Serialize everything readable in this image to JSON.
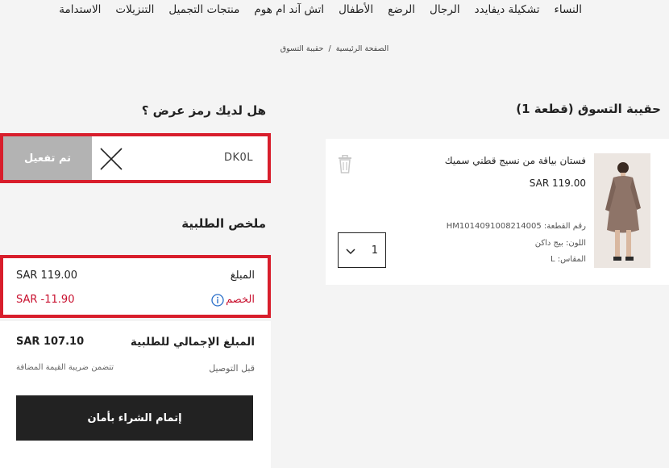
{
  "nav": [
    "النساء",
    "تشكيلة ديفايدد",
    "الرجال",
    "الرضع",
    "الأطفال",
    "اتش آند ام هوم",
    "منتجات التجميل",
    "التنزيلات",
    "الاستدامة"
  ],
  "breadcrumb": {
    "home": "الصفحة الرئيسية",
    "separator": "/",
    "current": "حقيبة التسوق"
  },
  "cart": {
    "title": "حقيبة التسوق (قطعة 1)",
    "item": {
      "name": "فستان بياقة من نسيج قطني سميك",
      "price": "SAR 119.00",
      "article_no": "رقم القطعة: HM1014091008214005",
      "color": "اللون: بيج داكن",
      "size": "المقاس: L",
      "quantity": "1",
      "image_colors": {
        "bg": "#ece6e1",
        "coat": "#8e7468"
      }
    }
  },
  "promo": {
    "question": "هل لديك رمز عرض ؟",
    "code": "DK0L",
    "button": "تم تفعيل"
  },
  "summary": {
    "title": "ملخص الطلبية",
    "amount_label": "المبلغ",
    "amount_value": "SAR 119.00",
    "discount_label": "الخصم",
    "discount_value": "SAR -11.90",
    "total_label": "المبلغ الإجمالي للطلبية",
    "total_value": "SAR 107.10",
    "before_delivery": "قبل التوصيل",
    "vat_note": "تتضمن ضريبة القيمة المضافة",
    "checkout": "إتمام الشراء بأمان"
  },
  "colors": {
    "accent_red": "#d81e2c",
    "discount_red": "#c8102e",
    "info_blue": "#2a6fc9",
    "dark": "#222222"
  }
}
